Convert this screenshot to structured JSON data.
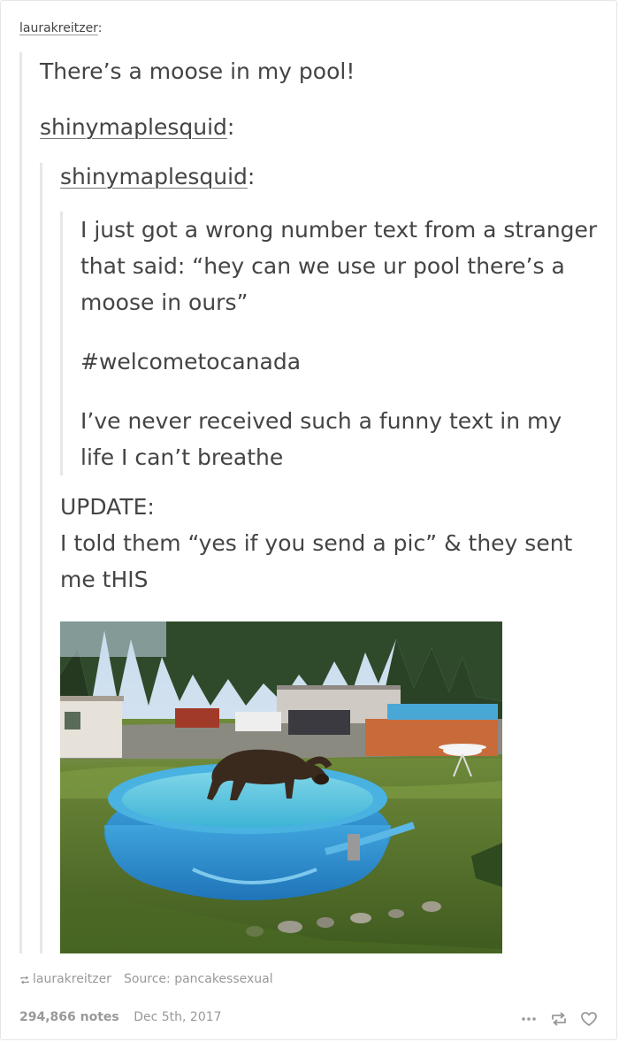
{
  "post": {
    "poster": "laurakreitzer",
    "poster_colon": ":",
    "main_text": "There’s a moose in my pool!",
    "reblogs": [
      {
        "username": "shinymaplesquid",
        "colon": ":"
      },
      {
        "username": "shinymaplesquid",
        "colon": ":"
      }
    ],
    "original_paragraphs": [
      "I just got a wrong number text from a stranger that said: “hey can we use ur pool there’s a moose in ours”",
      "#welcometocanada",
      "I’ve never received such a funny text in my life I can’t breathe"
    ],
    "update_heading": "UPDATE:",
    "update_body": "I told them “yes if you send a pic” & they sent me tHIS"
  },
  "source": {
    "reblogged_from": "laurakreitzer",
    "source_label": "Source: pancakessexual"
  },
  "footer": {
    "notes": "294,866 notes",
    "date": "Dec 5th, 2017"
  },
  "icons": {
    "more": "more-dots-icon",
    "reblog": "reblog-icon",
    "like": "heart-icon"
  }
}
